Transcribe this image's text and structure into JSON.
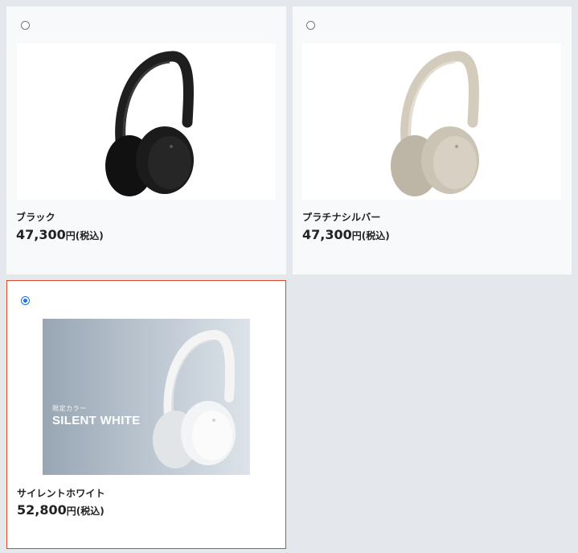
{
  "products": [
    {
      "name": "ブラック",
      "price": "47,300",
      "price_suffix": "円(税込)",
      "selected": false,
      "color": "#1e1e1e",
      "image_icon": "headphones-icon"
    },
    {
      "name": "プラチナシルバー",
      "price": "47,300",
      "price_suffix": "円(税込)",
      "selected": false,
      "color": "#cfc7b8",
      "image_icon": "headphones-icon"
    },
    {
      "name": "サイレントホワイト",
      "price": "52,800",
      "price_suffix": "円(税込)",
      "selected": true,
      "color": "#f2f2f2",
      "image_icon": "headphones-icon",
      "banner": {
        "small_text": "限定カラー",
        "big_text": "SILENT WHITE"
      }
    }
  ],
  "colors": {
    "selected_border": "#d94a2b",
    "radio_checked": "#1a73e8",
    "page_background": "#e4e7ec"
  }
}
